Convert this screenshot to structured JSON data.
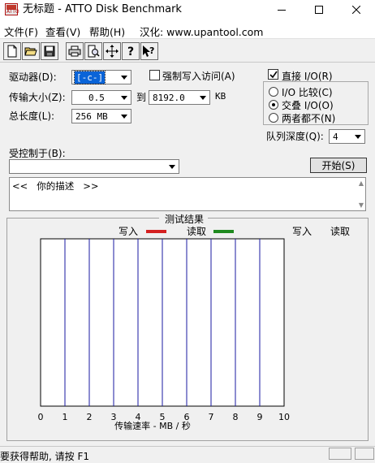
{
  "window": {
    "title": "无标题 - ATTO Disk Benchmark"
  },
  "menu": {
    "file": "文件(F)",
    "view": "查看(V)",
    "help": "帮助(H)",
    "localized": "汉化: www.upantool.com"
  },
  "toolbar": {
    "icons": [
      "new-icon",
      "open-icon",
      "save-icon",
      "print-icon",
      "print-preview-icon",
      "move-icon",
      "help-icon",
      "context-help-icon"
    ]
  },
  "controls": {
    "drive_label": "驱动器(D):",
    "drive_value": "[-c-]",
    "force_write_label": "强制写入访问(A)",
    "force_write_checked": false,
    "transfer_size_label": "传输大小(Z):",
    "transfer_from": "0.5",
    "to_label": "到",
    "transfer_to": "8192.0",
    "unit_kb": "KB",
    "total_length_label": "总长度(L):",
    "total_length": "256 MB",
    "direct_io_label": "直接 I/O(R)",
    "direct_io_checked": true,
    "io_compare_label": "I/O 比较(C)",
    "overlapped_io_label": "交叠 I/O(O)",
    "neither_label": "两者都不(N)",
    "selected_io_mode": "overlapped",
    "queue_depth_label": "队列深度(Q):",
    "queue_depth": "4",
    "controlled_by_label": "受控制于(B):",
    "controlled_by_value": "",
    "start_button": "开始(S)",
    "description_text": "<<   你的描述   >>"
  },
  "chart_data": {
    "type": "bar",
    "title": "测试结果",
    "legend": {
      "write": "写入",
      "read": "读取"
    },
    "colors": {
      "write": "#d42020",
      "read": "#1f8a1f"
    },
    "column_headers": {
      "write": "写入",
      "read": "读取"
    },
    "xlim": [
      0,
      10
    ],
    "x_ticks": [
      "0",
      "1",
      "2",
      "3",
      "4",
      "5",
      "6",
      "7",
      "8",
      "9",
      "10"
    ],
    "xlabel": "传输速率 - MB / 秒",
    "categories": [],
    "series": [
      {
        "name": "写入",
        "values": []
      },
      {
        "name": "读取",
        "values": []
      }
    ]
  },
  "status": {
    "text": "要获得帮助, 请按 F1"
  }
}
